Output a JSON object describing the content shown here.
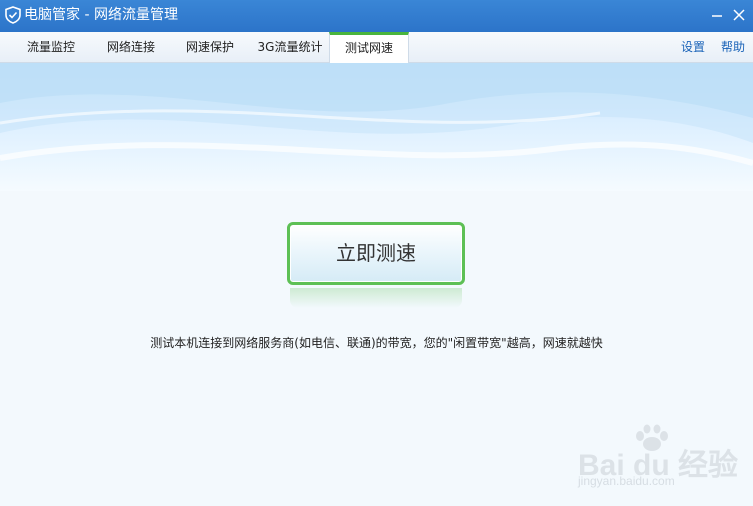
{
  "window": {
    "title": "电脑管家 - 网络流量管理"
  },
  "tabs": [
    {
      "label": "流量监控",
      "active": false
    },
    {
      "label": "网络连接",
      "active": false
    },
    {
      "label": "网速保护",
      "active": false
    },
    {
      "label": "3G流量统计",
      "active": false
    },
    {
      "label": "测试网速",
      "active": true
    }
  ],
  "links": {
    "settings": "设置",
    "help": "帮助"
  },
  "main": {
    "test_button_label": "立即测速",
    "description": "测试本机连接到网络服务商(如电信、联通)的带宽，您的\"闲置带宽\"越高，网速就越快"
  },
  "watermark": {
    "brand": "Bai du 经验",
    "sub": "jingyan.baidu.com"
  },
  "colors": {
    "titlebar": "#2c74c9",
    "active_tab_accent": "#49b43d",
    "button_border": "#5dc055",
    "link": "#1a63b8"
  }
}
